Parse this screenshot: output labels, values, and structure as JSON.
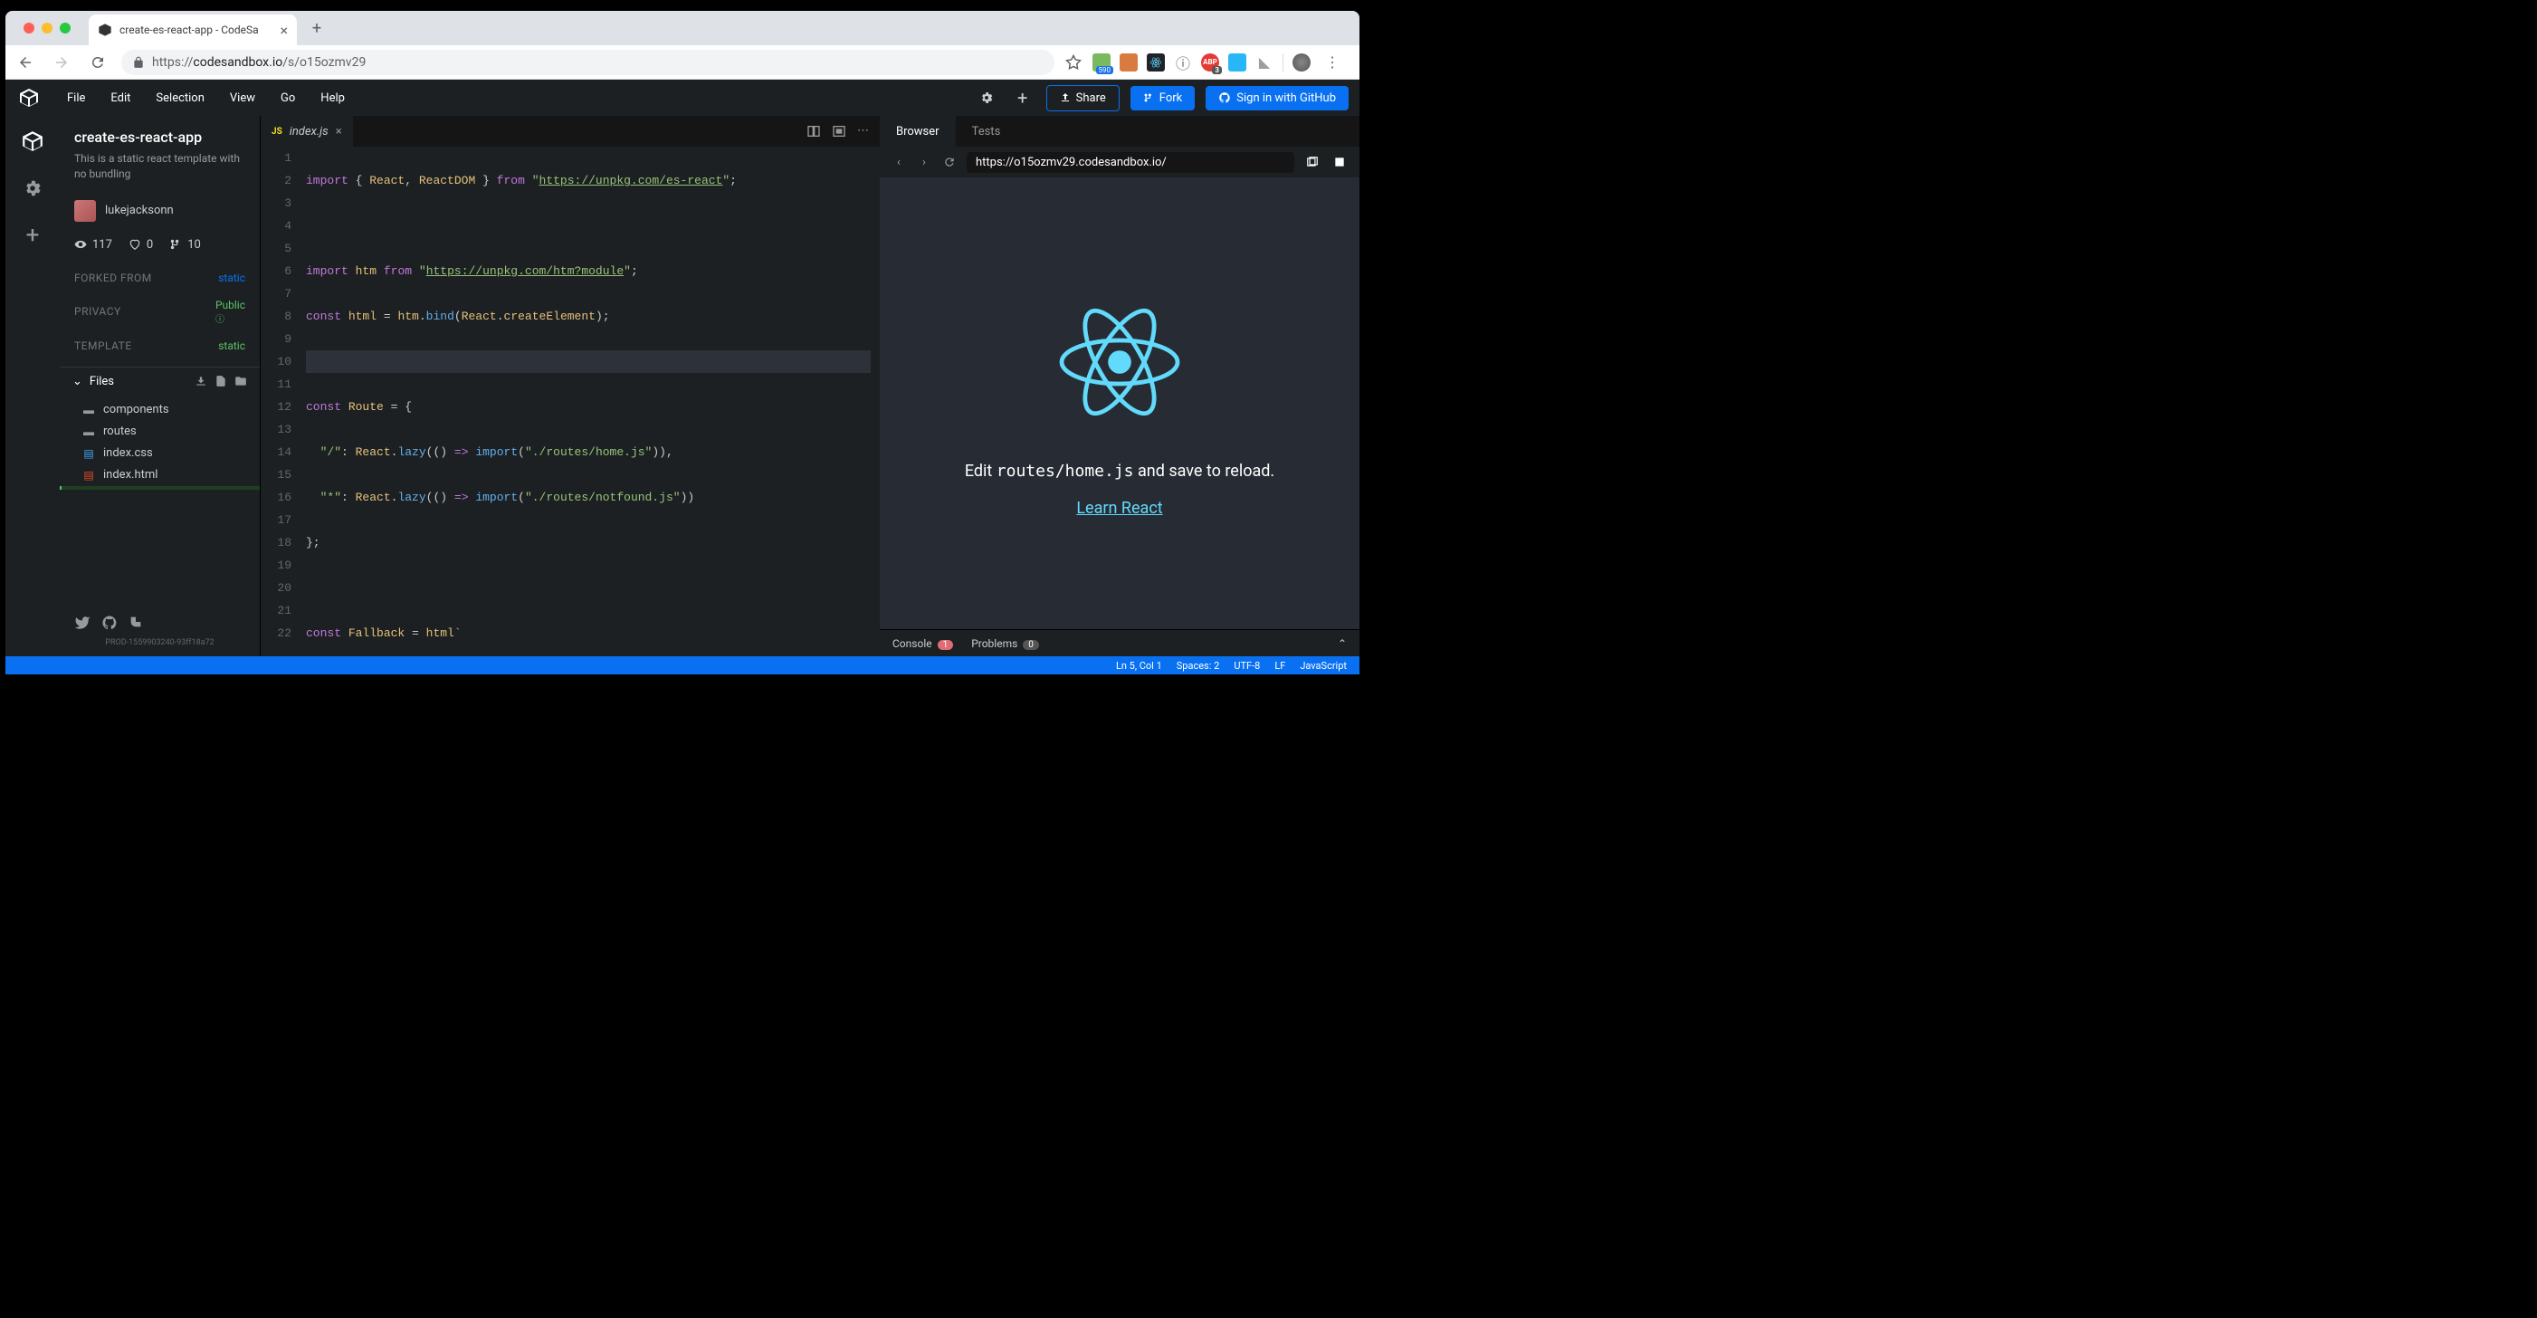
{
  "browser": {
    "tab_title": "create-es-react-app - CodeSa",
    "url_scheme": "https://",
    "url_host": "codesandbox.io",
    "url_path": "/s/o15ozmv29",
    "ext_badge_1": "590",
    "ext_badge_2": "3"
  },
  "menubar": {
    "items": [
      "File",
      "Edit",
      "Selection",
      "View",
      "Go",
      "Help"
    ],
    "share": "Share",
    "fork": "Fork",
    "signin": "Sign in with GitHub"
  },
  "sidebar": {
    "title": "create-es-react-app",
    "description": "This is a static react template with no bundling",
    "username": "lukejacksonn",
    "stats": {
      "views": "117",
      "likes": "0",
      "forks": "10"
    },
    "forked_label": "FORKED FROM",
    "forked_val": "static",
    "privacy_label": "PRIVACY",
    "privacy_val": "Public",
    "template_label": "TEMPLATE",
    "template_val": "static",
    "files_label": "Files",
    "files": [
      {
        "name": "components",
        "type": "folder"
      },
      {
        "name": "routes",
        "type": "folder"
      },
      {
        "name": "index.css",
        "type": "css"
      },
      {
        "name": "index.html",
        "type": "html"
      }
    ],
    "build": "PROD-1559903240-93ff18a72"
  },
  "editor": {
    "tab_name": "index.js",
    "lines": 22
  },
  "preview": {
    "tabs": [
      "Browser",
      "Tests"
    ],
    "url": "https://o15ozmv29.codesandbox.io/",
    "text_pre": "Edit ",
    "text_code": "routes/home.js",
    "text_post": " and save to reload.",
    "link": "Learn React",
    "console_label": "Console",
    "console_count": "1",
    "problems_label": "Problems",
    "problems_count": "0"
  },
  "statusbar": {
    "pos": "Ln 5, Col 1",
    "spaces": "Spaces: 2",
    "enc": "UTF-8",
    "eol": "LF",
    "lang": "JavaScript"
  }
}
